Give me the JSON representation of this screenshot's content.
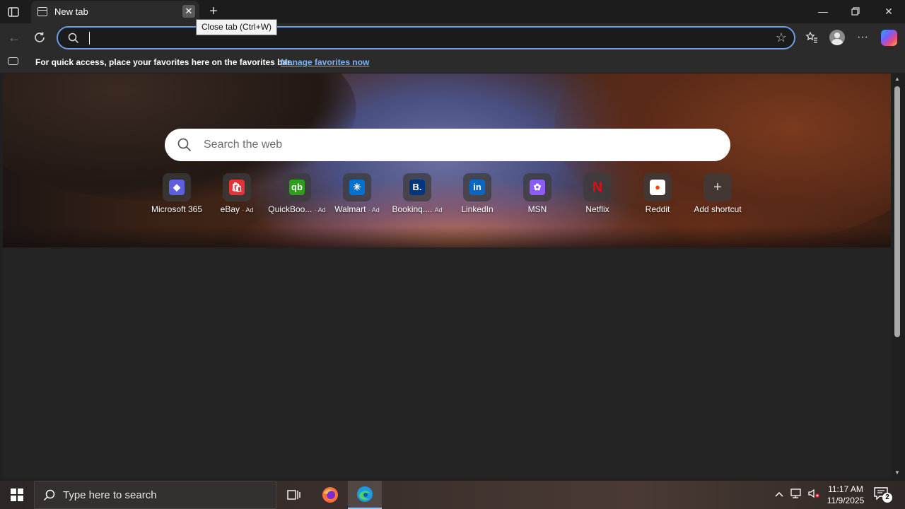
{
  "tab": {
    "title": "New tab",
    "close_tooltip": "Close tab (Ctrl+W)"
  },
  "address_bar": {
    "value": "",
    "placeholder": ""
  },
  "favorites_bar": {
    "message": "For quick access, place your favorites here on the favorites bar.",
    "link": "Manage favorites now"
  },
  "search": {
    "placeholder": "Search the web"
  },
  "shortcuts": [
    {
      "label": "Microsoft 365",
      "ad": "",
      "icon": "microsoft-365-icon",
      "color": "#5b5fe0",
      "glyph": "◆"
    },
    {
      "label": "eBay",
      "ad": "· Ad",
      "icon": "ebay-icon",
      "color": "#e53238",
      "glyph": "🛍"
    },
    {
      "label": "QuickBoo...",
      "ad": "· Ad",
      "icon": "quickbooks-icon",
      "color": "#2ca01c",
      "glyph": "qb"
    },
    {
      "label": "Walmart",
      "ad": "· Ad",
      "icon": "walmart-icon",
      "color": "#0071ce",
      "glyph": "✳"
    },
    {
      "label": "Bookinq....",
      "ad": "Ad",
      "icon": "booking-icon",
      "color": "#003580",
      "glyph": "B."
    },
    {
      "label": "LinkedIn",
      "ad": "",
      "icon": "linkedin-icon",
      "color": "#0a66c2",
      "glyph": "in"
    },
    {
      "label": "MSN",
      "ad": "",
      "icon": "msn-icon",
      "color": "#8b5cf6",
      "glyph": "✿"
    },
    {
      "label": "Netflix",
      "ad": "",
      "icon": "netflix-icon",
      "color": "#e50914",
      "glyph": "N"
    },
    {
      "label": "Reddit",
      "ad": "",
      "icon": "reddit-icon",
      "color": "#ff4500",
      "glyph": "●"
    },
    {
      "label": "Add shortcut",
      "ad": "",
      "icon": "plus-icon",
      "color": "transparent",
      "glyph": "+"
    }
  ],
  "taskbar": {
    "search_placeholder": "Type here to search",
    "time": "11:17 AM",
    "date": "11/9/2025",
    "notification_count": "2"
  },
  "colors": {
    "accent": "#6a9fe8",
    "link": "#7cb4f5"
  }
}
